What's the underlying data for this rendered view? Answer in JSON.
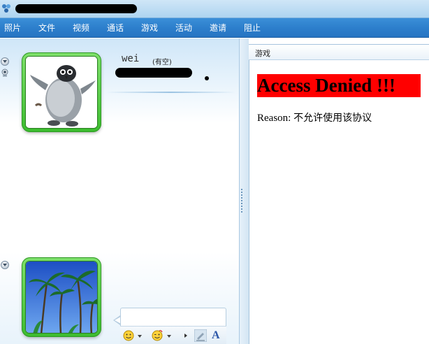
{
  "window": {
    "title_redacted": true
  },
  "menu": {
    "items": [
      "照片",
      "文件",
      "视频",
      "通话",
      "游戏",
      "活动",
      "邀请",
      "阻止"
    ]
  },
  "contact": {
    "name": "wei",
    "status": "(有空)",
    "signature_redacted": true
  },
  "input": {
    "value": "",
    "placeholder": ""
  },
  "toolbar": {
    "font_button_label": "A",
    "icons": [
      "smiley-icon",
      "wink-icon",
      "more-arrow-icon",
      "pen-icon",
      "font-icon"
    ]
  },
  "right_panel": {
    "title": "游戏",
    "error_heading": "Access Denied !!!",
    "reason_label": "Reason:",
    "reason_text": "不允许使用该协议"
  },
  "colors": {
    "menu_bar": "#2d7fcc",
    "avatar_frame": "#4cc83a",
    "error_banner": "#ff0000"
  }
}
